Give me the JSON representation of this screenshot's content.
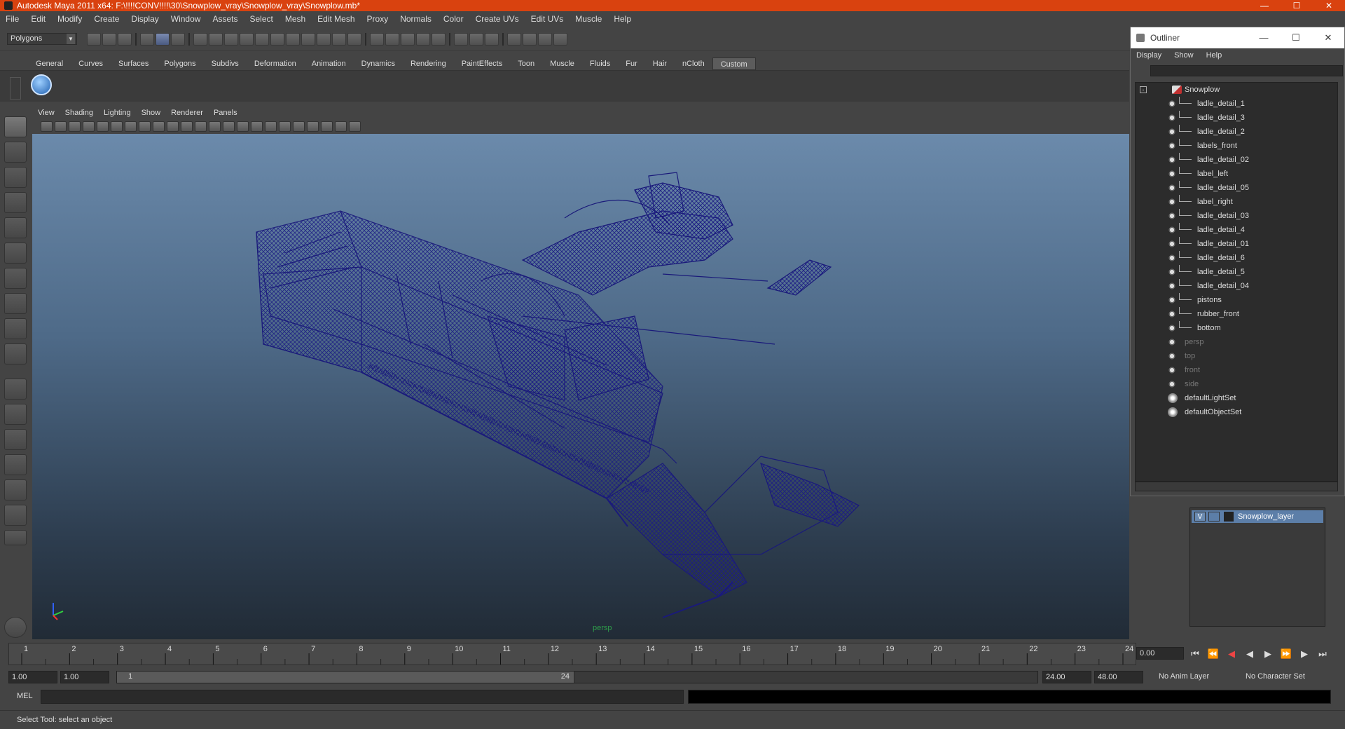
{
  "window": {
    "title": "Autodesk Maya 2011 x64: F:\\!!!!CONV!!!!\\30\\Snowplow_vray\\Snowplow_vray\\Snowplow.mb*"
  },
  "menubar": [
    "File",
    "Edit",
    "Modify",
    "Create",
    "Display",
    "Window",
    "Assets",
    "Select",
    "Mesh",
    "Edit Mesh",
    "Proxy",
    "Normals",
    "Color",
    "Create UVs",
    "Edit UVs",
    "Muscle",
    "Help"
  ],
  "mode_selector": {
    "value": "Polygons"
  },
  "shelf_tabs": [
    "General",
    "Curves",
    "Surfaces",
    "Polygons",
    "Subdivs",
    "Deformation",
    "Animation",
    "Dynamics",
    "Rendering",
    "PaintEffects",
    "Toon",
    "Muscle",
    "Fluids",
    "Fur",
    "Hair",
    "nCloth",
    "Custom"
  ],
  "shelf_active": "Custom",
  "panel_menu": [
    "View",
    "Shading",
    "Lighting",
    "Show",
    "Renderer",
    "Panels"
  ],
  "viewport": {
    "camera_label": "persp"
  },
  "timeline": {
    "ticks": [
      "1",
      "2",
      "3",
      "4",
      "5",
      "6",
      "7",
      "8",
      "9",
      "10",
      "11",
      "12",
      "13",
      "14",
      "15",
      "16",
      "17",
      "18",
      "19",
      "20",
      "21",
      "22",
      "23",
      "24"
    ],
    "current_frame": "0.00"
  },
  "range": {
    "start": "1.00",
    "playback_start": "1.00",
    "slider_start": "1",
    "slider_end": "24",
    "playback_end": "24.00",
    "end": "48.00",
    "anim_layer": "No Anim Layer",
    "character_set": "No Character Set"
  },
  "mel": {
    "label": "MEL"
  },
  "help_line": "Select Tool: select an object",
  "outliner": {
    "title": "Outliner",
    "menu": [
      "Display",
      "Show",
      "Help"
    ],
    "root": "Snowplow",
    "children": [
      "ladle_detail_1",
      "ladle_detail_3",
      "ladle_detail_2",
      "labels_front",
      "ladle_detail_02",
      "label_left",
      "ladle_detail_05",
      "label_right",
      "ladle_detail_03",
      "ladle_detail_4",
      "ladle_detail_01",
      "ladle_detail_6",
      "ladle_detail_5",
      "ladle_detail_04",
      "pistons",
      "rubber_front",
      "bottom"
    ],
    "cameras": [
      "persp",
      "top",
      "front",
      "side"
    ],
    "sets": [
      "defaultLightSet",
      "defaultObjectSet"
    ]
  },
  "layers": {
    "items": [
      {
        "visible": "V",
        "name": "Snowplow_layer"
      }
    ]
  },
  "colors": {
    "title_bar": "#d9420f",
    "wireframe": "#1a1a7a",
    "layer_selected": "#5c7ea8"
  }
}
